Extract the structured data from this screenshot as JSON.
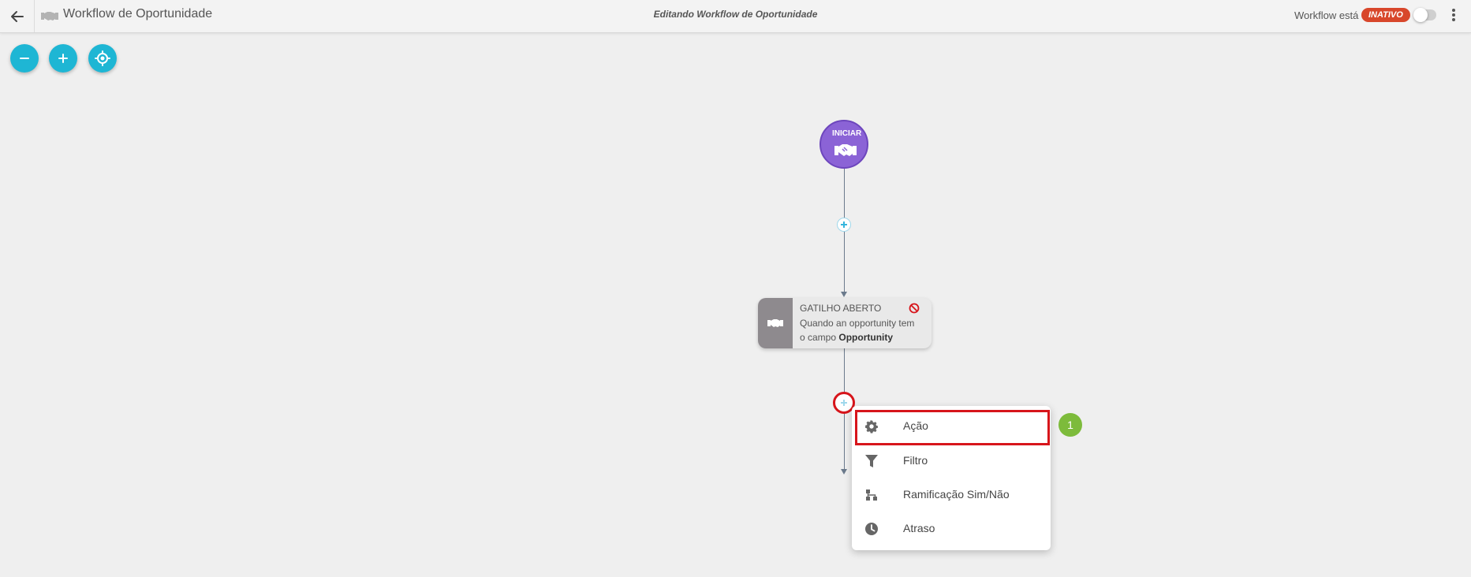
{
  "header": {
    "title": "Workflow de Oportunidade",
    "center_title": "Editando Workflow de Oportunidade",
    "status_label": "Workflow está",
    "status_badge": "INATIVO",
    "status_color": "#d8472b",
    "toggle_on": false
  },
  "zoom_controls": [
    {
      "icon": "minus-icon"
    },
    {
      "icon": "plus-icon"
    },
    {
      "icon": "locate-icon"
    }
  ],
  "flow": {
    "start_label": "INICIAR",
    "trigger": {
      "title": "GATILHO ABERTO",
      "desc_line1": "Quando an opportunity tem",
      "desc_prefix": "o campo",
      "desc_bold": "Opportunity"
    }
  },
  "menu": {
    "items": [
      {
        "label": "Ação",
        "icon": "gear-icon"
      },
      {
        "label": "Filtro",
        "icon": "filter-icon"
      },
      {
        "label": "Ramificação Sim/Não",
        "icon": "branch-icon"
      },
      {
        "label": "Atraso",
        "icon": "clock-icon"
      }
    ]
  },
  "annotation": {
    "step": "1"
  },
  "colors": {
    "accent": "#1eb6d4",
    "start_node": "#8b63d6",
    "highlight": "#d7151b",
    "badge": "#7dbb3b"
  }
}
